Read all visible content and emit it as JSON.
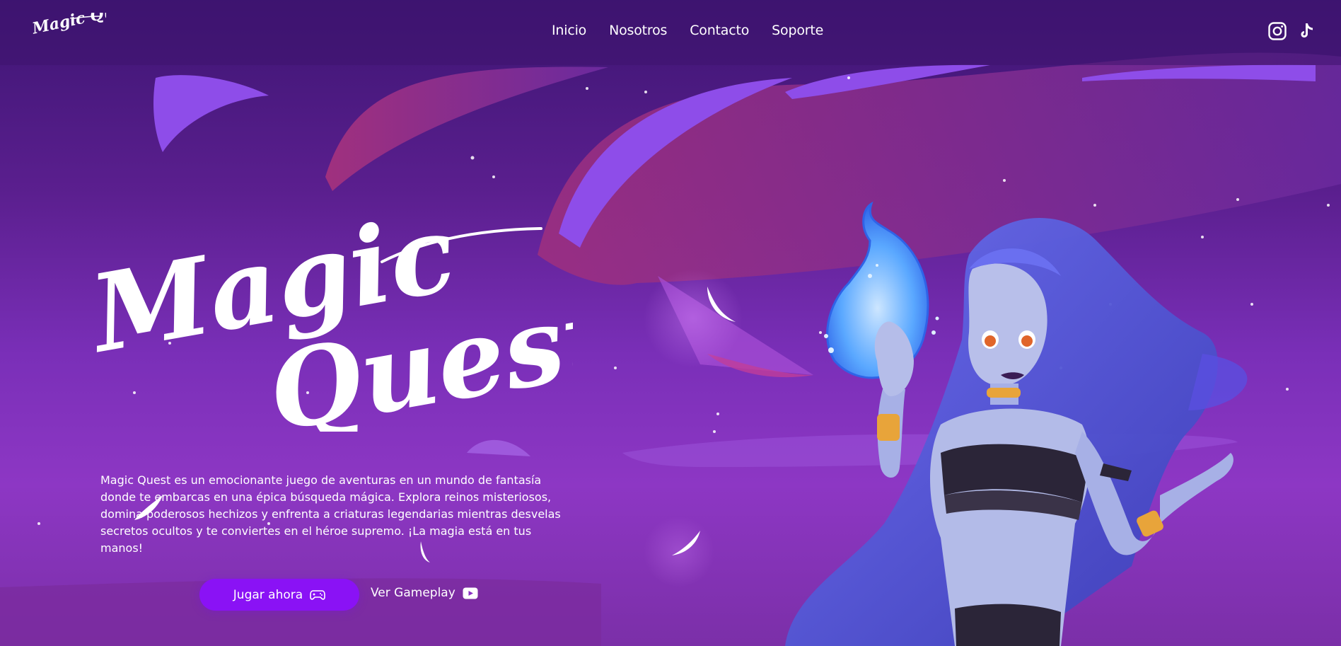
{
  "header": {
    "logo_text": "Magic Quest",
    "nav": [
      {
        "label": "Inicio"
      },
      {
        "label": "Nosotros"
      },
      {
        "label": "Contacto"
      },
      {
        "label": "Soporte"
      }
    ],
    "social": [
      {
        "icon": "instagram-icon"
      },
      {
        "icon": "tiktok-icon"
      }
    ]
  },
  "hero": {
    "title_line1": "Magic",
    "title_line2": "Quest",
    "description": "Magic Quest es un emocionante juego de aventuras en un mundo de fantasía donde te embarcas en una épica búsqueda mágica. Explora reinos misteriosos, domina poderosos hechizos y enfrenta a criaturas legendarias mientras desvelas secretos ocultos y te conviertes en el héroe supremo. ¡La magia está en tus manos!",
    "primary_button": {
      "label": "Jugar ahora",
      "icon": "gamepad-icon"
    },
    "secondary_button": {
      "label": "Ver Gameplay",
      "icon": "youtube-icon"
    }
  },
  "colors": {
    "primary_button": "#8a12f5",
    "background_top": "#3d1573",
    "background_bottom": "#8d37c4",
    "text": "#ffffff"
  }
}
